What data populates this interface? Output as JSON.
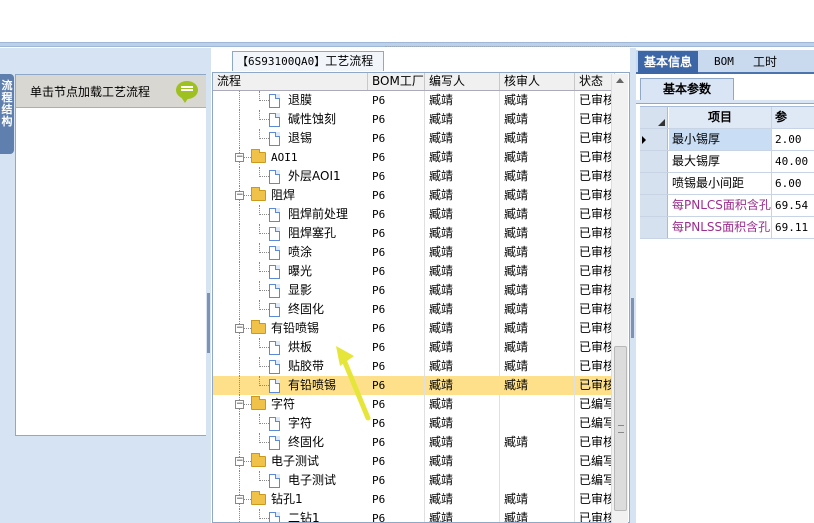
{
  "left_panel": {
    "side_tab": "流程结构",
    "hint": "单击节点加载工艺流程"
  },
  "middle": {
    "title_code": "【6S93100QA0】",
    "title_text": "工艺流程",
    "columns": [
      "流程",
      "BOM工厂",
      "编写人",
      "核审人",
      "状态"
    ],
    "rows": [
      {
        "name": "退膜",
        "depth": 2,
        "type": "doc",
        "factory": "P6",
        "writer": "臧靖",
        "checker": "臧靖",
        "status": "已审核",
        "selected": false
      },
      {
        "name": "碱性蚀刻",
        "depth": 2,
        "type": "doc",
        "factory": "P6",
        "writer": "臧靖",
        "checker": "臧靖",
        "status": "已审核",
        "selected": false
      },
      {
        "name": "退锡",
        "depth": 2,
        "type": "doc",
        "factory": "P6",
        "writer": "臧靖",
        "checker": "臧靖",
        "status": "已审核",
        "selected": false
      },
      {
        "name": "AOI1",
        "depth": 1,
        "type": "folder",
        "factory": "P6",
        "writer": "臧靖",
        "checker": "臧靖",
        "status": "已审核",
        "selected": false
      },
      {
        "name": "外层AOI1",
        "depth": 2,
        "type": "doc",
        "factory": "P6",
        "writer": "臧靖",
        "checker": "臧靖",
        "status": "已审核",
        "selected": false
      },
      {
        "name": "阻焊",
        "depth": 1,
        "type": "folder",
        "factory": "P6",
        "writer": "臧靖",
        "checker": "臧靖",
        "status": "已审核",
        "selected": false
      },
      {
        "name": "阻焊前处理",
        "depth": 2,
        "type": "doc",
        "factory": "P6",
        "writer": "臧靖",
        "checker": "臧靖",
        "status": "已审核",
        "selected": false
      },
      {
        "name": "阻焊塞孔",
        "depth": 2,
        "type": "doc",
        "factory": "P6",
        "writer": "臧靖",
        "checker": "臧靖",
        "status": "已审核",
        "selected": false
      },
      {
        "name": "喷涂",
        "depth": 2,
        "type": "doc",
        "factory": "P6",
        "writer": "臧靖",
        "checker": "臧靖",
        "status": "已审核",
        "selected": false
      },
      {
        "name": "曝光",
        "depth": 2,
        "type": "doc",
        "factory": "P6",
        "writer": "臧靖",
        "checker": "臧靖",
        "status": "已审核",
        "selected": false
      },
      {
        "name": "显影",
        "depth": 2,
        "type": "doc",
        "factory": "P6",
        "writer": "臧靖",
        "checker": "臧靖",
        "status": "已审核",
        "selected": false
      },
      {
        "name": "终固化",
        "depth": 2,
        "type": "doc",
        "factory": "P6",
        "writer": "臧靖",
        "checker": "臧靖",
        "status": "已审核",
        "selected": false
      },
      {
        "name": "有铅喷锡",
        "depth": 1,
        "type": "folder",
        "factory": "P6",
        "writer": "臧靖",
        "checker": "臧靖",
        "status": "已审核",
        "selected": false
      },
      {
        "name": "烘板",
        "depth": 2,
        "type": "doc",
        "factory": "P6",
        "writer": "臧靖",
        "checker": "臧靖",
        "status": "已审核",
        "selected": false
      },
      {
        "name": "贴胶带",
        "depth": 2,
        "type": "doc",
        "factory": "P6",
        "writer": "臧靖",
        "checker": "臧靖",
        "status": "已审核",
        "selected": false
      },
      {
        "name": "有铅喷锡",
        "depth": 2,
        "type": "doc",
        "factory": "P6",
        "writer": "臧靖",
        "checker": "臧靖",
        "status": "已审核",
        "selected": true
      },
      {
        "name": "字符",
        "depth": 1,
        "type": "folder",
        "factory": "P6",
        "writer": "臧靖",
        "checker": "",
        "status": "已编写",
        "selected": false
      },
      {
        "name": "字符",
        "depth": 2,
        "type": "doc",
        "factory": "P6",
        "writer": "臧靖",
        "checker": "",
        "status": "已编写",
        "selected": false
      },
      {
        "name": "终固化",
        "depth": 2,
        "type": "doc",
        "factory": "P6",
        "writer": "臧靖",
        "checker": "臧靖",
        "status": "已审核",
        "selected": false
      },
      {
        "name": "电子测试",
        "depth": 1,
        "type": "folder",
        "factory": "P6",
        "writer": "臧靖",
        "checker": "",
        "status": "已编写",
        "selected": false
      },
      {
        "name": "电子测试",
        "depth": 2,
        "type": "doc",
        "factory": "P6",
        "writer": "臧靖",
        "checker": "",
        "status": "已编写",
        "selected": false
      },
      {
        "name": "钻孔1",
        "depth": 1,
        "type": "folder",
        "factory": "P6",
        "writer": "臧靖",
        "checker": "臧靖",
        "status": "已审核",
        "selected": false
      },
      {
        "name": "二钻1",
        "depth": 2,
        "type": "doc",
        "factory": "P6",
        "writer": "臧靖",
        "checker": "臧靖",
        "status": "已审核",
        "selected": false
      }
    ]
  },
  "right": {
    "tabs": [
      "基本信息",
      "BOM",
      "工时"
    ],
    "active_tab": 0,
    "subtab": "基本参数",
    "header_item": "项目",
    "header_value": "参",
    "params": [
      {
        "name": "最小锡厚",
        "value": "2.00",
        "highlight": true,
        "current": true,
        "purple": false
      },
      {
        "name": "最大锡厚",
        "value": "40.00",
        "highlight": false,
        "current": false,
        "purple": false
      },
      {
        "name": "喷锡最小间距",
        "value": "6.00",
        "highlight": false,
        "current": false,
        "purple": false
      },
      {
        "name": "每PNLCS面积含孔",
        "value": "69.54",
        "highlight": false,
        "current": false,
        "purple": true
      },
      {
        "name": "每PNLSS面积含孔",
        "value": "69.11",
        "highlight": false,
        "current": false,
        "purple": true
      }
    ]
  },
  "colors": {
    "accent": "#3d66a6",
    "selected_row": "#ffe08a",
    "folder": "#f1c24a",
    "annotation_arrow": "#e6e63a",
    "purple_text": "#9b2d8e"
  },
  "icons": [
    "comment-bubble-icon",
    "folder-icon",
    "document-icon",
    "expand-collapse-icon",
    "row-pointer-icon",
    "annotation-arrow"
  ]
}
